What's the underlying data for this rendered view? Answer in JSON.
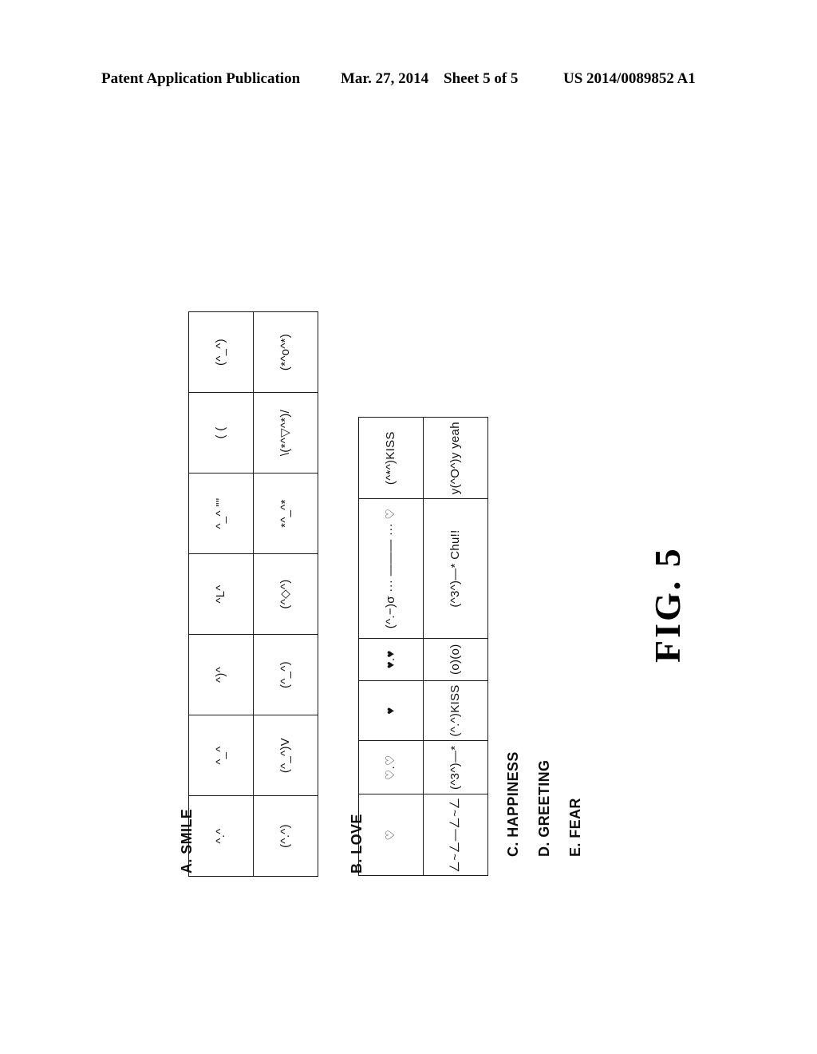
{
  "header": {
    "publication": "Patent Application Publication",
    "date": "Mar. 27, 2014",
    "sheet": "Sheet 5 of 5",
    "number": "US 2014/0089852 A1"
  },
  "figure": {
    "label": "FIG. 5"
  },
  "tables": {
    "a": {
      "label": "A. SMILE",
      "rows": [
        [
          "^.^",
          "^_^",
          "^)^",
          "^L^",
          "^_^ \"\"",
          "( (",
          "(^_^)"
        ],
        [
          "(^.^)",
          "(^_^)V",
          "(^_^)",
          "(^◇^)",
          "*^_^*",
          "\\(*^▽^*)/",
          "(*^o^*)"
        ]
      ]
    },
    "b": {
      "label": "B. LOVE",
      "rows": [
        [
          "♡",
          "♡.♡",
          "♥",
          "♥.♥",
          "(^.−)σ ··· ——— ··· ♡",
          "(^*^)KISS"
        ],
        [
          "ㄥ~ㄥ—ㄥ~ㄥ",
          "(^3^)—*",
          "(^.^)KISS",
          "(o)(o)",
          "(^3^)—* Chu!!",
          "y(^O^)y yeah"
        ]
      ]
    }
  },
  "other_labels": [
    "C. HAPPINESS",
    "D. GREETING",
    "E. FEAR"
  ],
  "colors": {
    "ink": "#000000",
    "page": "#ffffff"
  }
}
